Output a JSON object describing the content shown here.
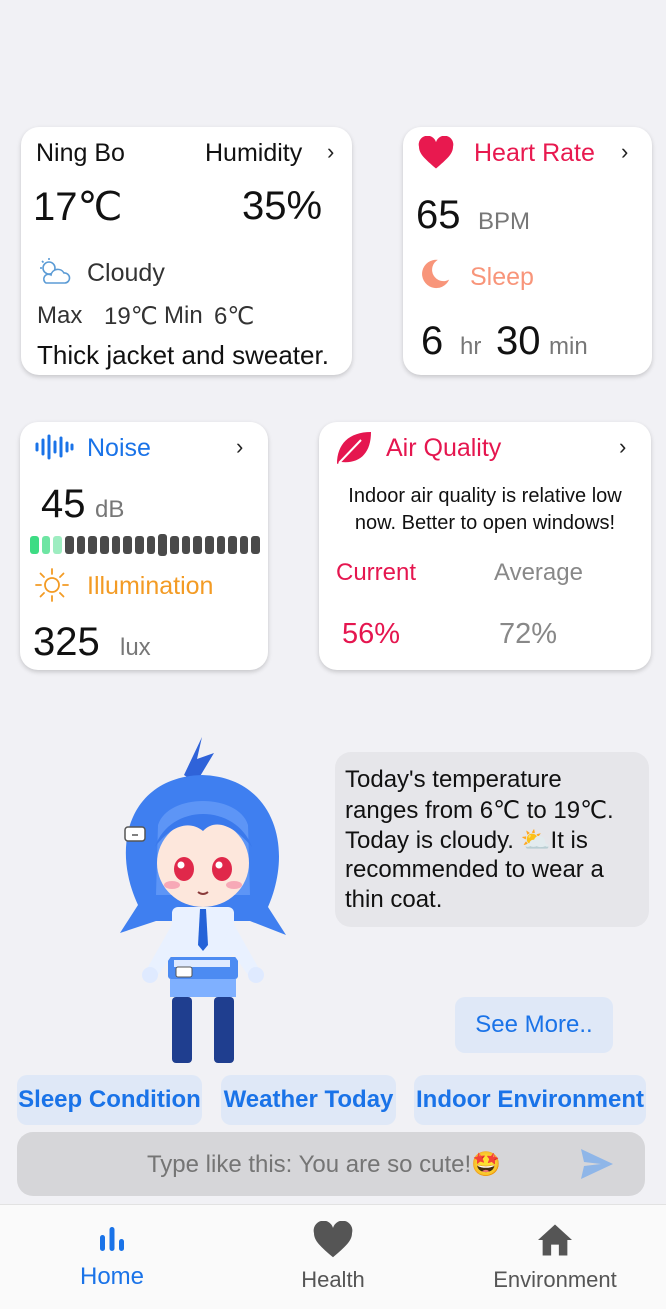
{
  "weather": {
    "city": "Ning Bo",
    "humidity_label": "Humidity",
    "temp": "17℃",
    "humidity": "35%",
    "condition": "Cloudy",
    "max_label": "Max",
    "max": "19℃",
    "min_label": "Min",
    "min": "6℃",
    "advice": "Thick jacket and sweater."
  },
  "heart": {
    "title": "Heart Rate",
    "value": "65",
    "unit": "BPM",
    "sleep_title": "Sleep",
    "hours": "6",
    "hr_unit": "hr",
    "minutes": "30",
    "min_unit": "min"
  },
  "noise": {
    "title": "Noise",
    "value": "45",
    "unit": "dB",
    "level_segments": 20,
    "level_active": 3,
    "illum_title": "Illumination",
    "illum_value": "325",
    "illum_unit": "lux"
  },
  "air": {
    "title": "Air Quality",
    "desc_line1": "Indoor air quality is relative low",
    "desc_line2": "now. Better to open windows!",
    "current_label": "Current",
    "average_label": "Average",
    "current": "56%",
    "average": "72%"
  },
  "bubble": {
    "l1": "Today's temperature",
    "l2": "ranges from 6℃ to 19℃.",
    "l3": "Today is cloudy. ⛅It is",
    "l4": "recommended to wear a",
    "l5": "thin coat."
  },
  "see_more": "See More..",
  "quick": {
    "sleep": "Sleep Condition",
    "weather": "Weather Today",
    "indoor": "Indoor Environment"
  },
  "input": {
    "placeholder": "Type like this: You are so cute!🤩"
  },
  "nav": {
    "home": "Home",
    "health": "Health",
    "environment": "Environment"
  },
  "colors": {
    "accent": "#1a73e8",
    "heart": "#e8194f",
    "sleep": "#f8957a",
    "illum": "#f39b24",
    "air": "#e5164f",
    "noise_active": "#3ddc84",
    "noise_inactive": "#4a4a4a"
  }
}
